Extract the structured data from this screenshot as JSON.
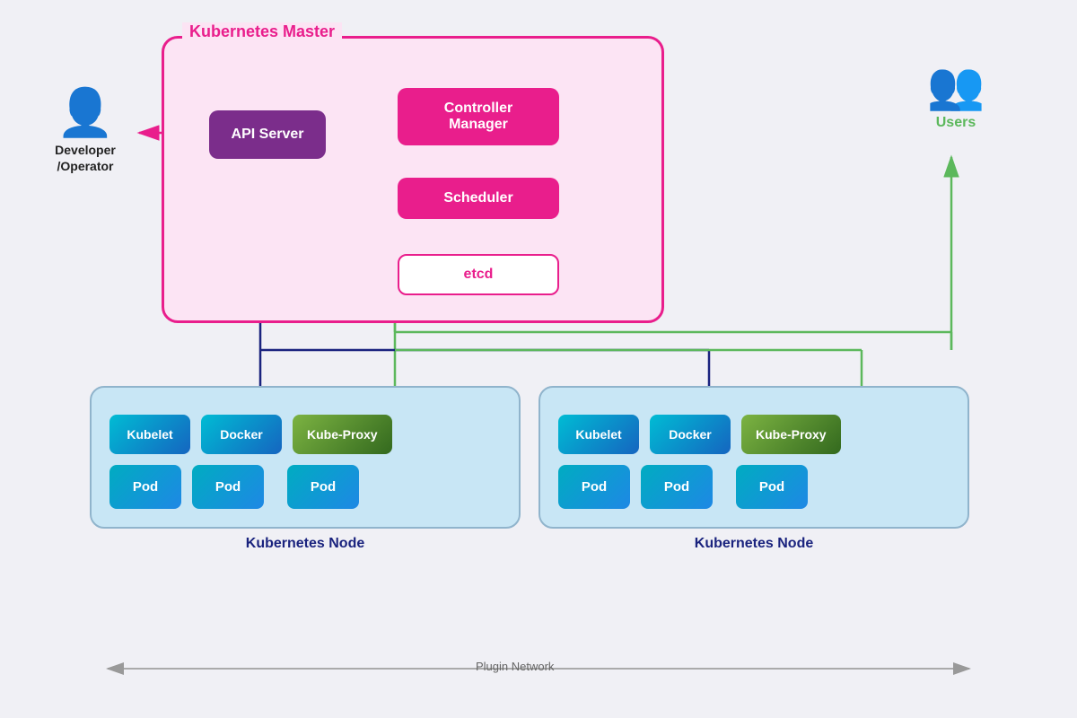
{
  "developer": {
    "label": "Developer\n/Operator"
  },
  "users": {
    "label": "Users"
  },
  "master": {
    "title": "Kubernetes Master",
    "api_server": "API Server",
    "controller_manager": "Controller\nManager",
    "scheduler": "Scheduler",
    "etcd": "etcd"
  },
  "nodes": [
    {
      "label": "Kubernetes Node",
      "kubelet": "Kubelet",
      "docker": "Docker",
      "kube_proxy": "Kube-Proxy",
      "pods": [
        "Pod",
        "Pod",
        "Pod"
      ]
    },
    {
      "label": "Kubernetes Node",
      "kubelet": "Kubelet",
      "docker": "Docker",
      "kube_proxy": "Kube-Proxy",
      "pods": [
        "Pod",
        "Pod",
        "Pod"
      ]
    }
  ],
  "plugin_network": "Plugin Network",
  "colors": {
    "pink": "#e91e8c",
    "purple": "#7B2D8B",
    "green": "#5cb85c",
    "dark_blue": "#1a237e",
    "teal": "#00bcd4",
    "node_blue": "#1565c0"
  }
}
